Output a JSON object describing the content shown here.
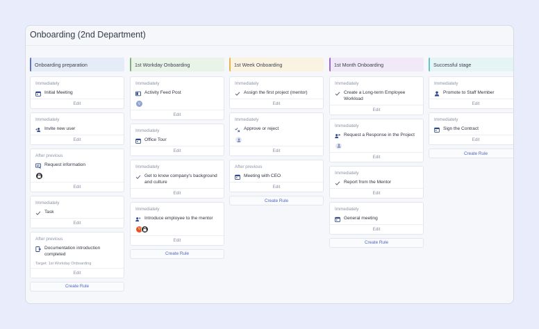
{
  "title": "Onboarding (2nd Department)",
  "colors": {
    "accent_blue": "#4a67c8",
    "col1": "#5b74c9",
    "col1_bg": "#e6ebf8",
    "col2": "#7fb27a",
    "col2_bg": "#eaf3e8",
    "col3": "#e3b54a",
    "col3_bg": "#fbf3e2",
    "col4": "#9c6cc2",
    "col4_bg": "#f1e9f7",
    "col5": "#67c3c7",
    "col5_bg": "#e5f5f6"
  },
  "columns": [
    {
      "header": "Onboarding preparation",
      "cards": [
        {
          "timing": "Immediately",
          "icon": "calendar-icon",
          "action": "Initial Meeting",
          "edit": "Edit"
        },
        {
          "timing": "Immediately",
          "icon": "add-user-icon",
          "action": "Invite new user",
          "edit": "Edit"
        },
        {
          "timing": "After previous",
          "icon": "form-icon",
          "action": "Request information",
          "avatar": "lock-icon",
          "edit": "Edit"
        },
        {
          "timing": "Immediately",
          "icon": "check-icon",
          "action": "Task",
          "edit": "Edit"
        },
        {
          "timing": "After previous",
          "icon": "document-icon",
          "action": "Documentation introduction completed",
          "target": "Target: 1st Workday Onboarding",
          "edit": "Edit"
        }
      ],
      "create_rule": "Create Rule"
    },
    {
      "header": "1st Workday Onboarding",
      "cards": [
        {
          "timing": "Immediately",
          "icon": "feed-icon",
          "action": "Activity Feed Post",
          "avatar_letter": "V",
          "edit": "Edit"
        },
        {
          "timing": "Immediately",
          "icon": "calendar-icon",
          "action": "Office Tour",
          "edit": "Edit"
        },
        {
          "timing": "Immediately",
          "icon": "check-icon",
          "action": "Get to know company's background and culture",
          "edit": "Edit"
        },
        {
          "timing": "Immediately",
          "icon": "mentor-icon",
          "action": "Introduce employee to the mentor",
          "avatar_letter": "V",
          "avatar2": "lock-icon",
          "edit": "Edit"
        }
      ],
      "create_rule": "Create Rule"
    },
    {
      "header": "1st Week Onboarding",
      "cards": [
        {
          "timing": "Immediately",
          "icon": "check-icon",
          "action": "Assign the first project (mentor)",
          "edit": "Edit"
        },
        {
          "timing": "Immediately",
          "icon": "approve-icon",
          "action": "Approve or reject",
          "avatar_user": "user-icon",
          "edit": "Edit"
        },
        {
          "timing": "After previous",
          "icon": "calendar-icon",
          "action": "Meeting with CEO",
          "edit": "Edit"
        }
      ],
      "create_rule": "Create Rule"
    },
    {
      "header": "1st Month Onboarding",
      "cards": [
        {
          "timing": "Immediately",
          "icon": "check-icon",
          "action": "Create a Long-term Employee Workload",
          "edit": "Edit"
        },
        {
          "timing": "Immediately",
          "icon": "request-icon",
          "action": "Request a Response in the Project",
          "avatar_user": "user-icon",
          "edit": "Edit"
        },
        {
          "timing": "Immediately",
          "icon": "check-icon",
          "action": "Report from the Mentor",
          "edit": "Edit"
        },
        {
          "timing": "Immediately",
          "icon": "calendar-icon",
          "action": "General meeting",
          "edit": "Edit"
        }
      ],
      "create_rule": "Create Rule"
    },
    {
      "header": "Successful stage",
      "cards": [
        {
          "timing": "Immediately",
          "icon": "user-icon",
          "action": "Promote to Staff Member",
          "edit": "Edit"
        },
        {
          "timing": "Immediately",
          "icon": "calendar-icon",
          "action": "Sign the Contract",
          "edit": "Edit"
        }
      ],
      "create_rule": "Create Rule"
    }
  ]
}
